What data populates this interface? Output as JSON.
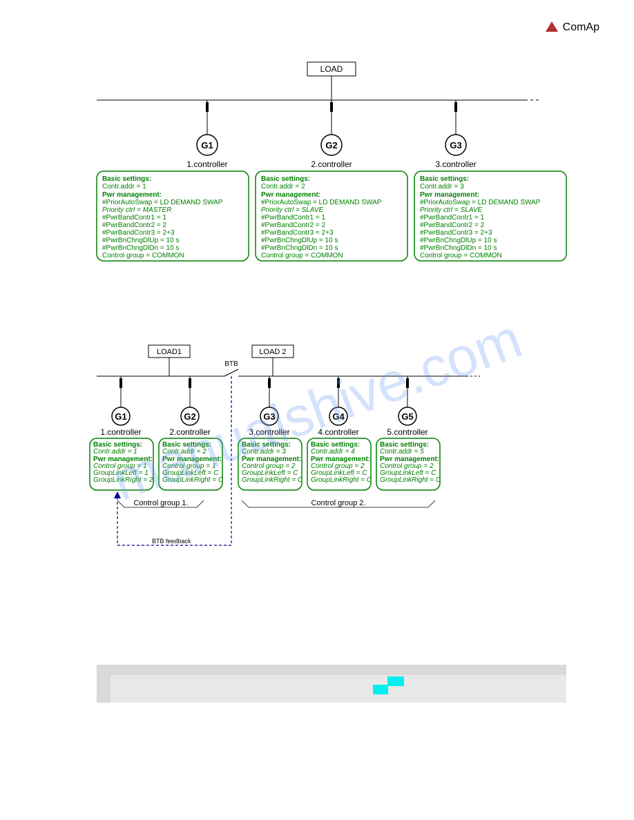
{
  "brand": "ComAp",
  "watermark": "manualshive.com",
  "diagram1": {
    "load": "LOAD",
    "gens": [
      "G1",
      "G2",
      "G3"
    ],
    "ctrls": [
      "1.controller",
      "2.controller",
      "3.controller"
    ],
    "cfg": [
      {
        "bs": "Basic settings:",
        "addr": "Contr.addr = 1",
        "pm": "Pwr management:",
        "lines": [
          "#PriorAutoSwap = LD DEMAND SWAP",
          "Priority ctrl        = MASTER",
          "#PwrBandContr1   = 1",
          "#PwrBandContr2   = 2",
          "#PwrBandContr3   = 2+3",
          "#PwrBnChngDlUp  = 10 s",
          "#PwrBnChngDlDn  = 10 s",
          "Control group      = COMMON"
        ]
      },
      {
        "bs": "Basic settings:",
        "addr": "Contr.addr = 2",
        "pm": "Pwr management:",
        "lines": [
          "#PriorAutoSwap = LD DEMAND SWAP",
          "Priority ctrl        = SLAVE",
          "#PwrBandContr1   = 1",
          "#PwrBandContr2   = 2",
          "#PwrBandContr3   = 2+3",
          "#PwrBnChngDlUp  = 10 s",
          "#PwrBnChngDlDn  = 10 s",
          "Control group      = COMMON"
        ]
      },
      {
        "bs": "Basic settings:",
        "addr": "Contr.addr = 3",
        "pm": "Pwr management:",
        "lines": [
          "#PriorAutoSwap = LD DEMAND SWAP",
          "Priority ctrl        = SLAVE",
          "#PwrBandContr1   = 1",
          "#PwrBandContr2   = 2",
          "#PwrBandContr3   = 2+3",
          "#PwrBnChngDlUp  = 10 s",
          "#PwrBnChngDlDn  = 10 s",
          "Control group      = COMMON"
        ]
      }
    ]
  },
  "diagram2": {
    "loads": [
      "LOAD1",
      "LOAD 2"
    ],
    "btb": "BTB",
    "gens": [
      "G1",
      "G2",
      "G3",
      "G4",
      "G5"
    ],
    "ctrls": [
      "1.controller",
      "2.controller",
      "3.controller",
      "4.controller",
      "5.controller"
    ],
    "cfg": [
      {
        "bs": "Basic settings:",
        "addr": "Contr.addr = 1",
        "pm": "Pwr management:",
        "cg": "Control group = 1",
        "gl": "GroupLinkLeft = 1",
        "gr": "GroupLinkRight = 2"
      },
      {
        "bs": "Basic settings:",
        "addr": "Contr.addr = 2",
        "pm": "Pwr management:",
        "cg": "Control group = 1",
        "gl": "GroupLinkLeft = C",
        "gr": "GroupLinkRight = C"
      },
      {
        "bs": "Basic settings:",
        "addr": "Contr.addr = 3",
        "pm": "Pwr management:",
        "cg": "Control group = 2",
        "gl": "GroupLinkLeft = C",
        "gr": "GroupLinkRight = C"
      },
      {
        "bs": "Basic settings:",
        "addr": "Contr.addr = 4",
        "pm": "Pwr management:",
        "cg": "Control group = 2",
        "gl": "GroupLinkLeft = C",
        "gr": "GroupLinkRight = C"
      },
      {
        "bs": "Basic settings:",
        "addr": "Contr.addr = 5",
        "pm": "Pwr management:",
        "cg": "Control group = 2",
        "gl": "GroupLinkLeft = C",
        "gr": "GroupLinkRight = C"
      }
    ],
    "group1": "Control group 1.",
    "group2": "Control group 2.",
    "btbf": "BTB feedback"
  }
}
